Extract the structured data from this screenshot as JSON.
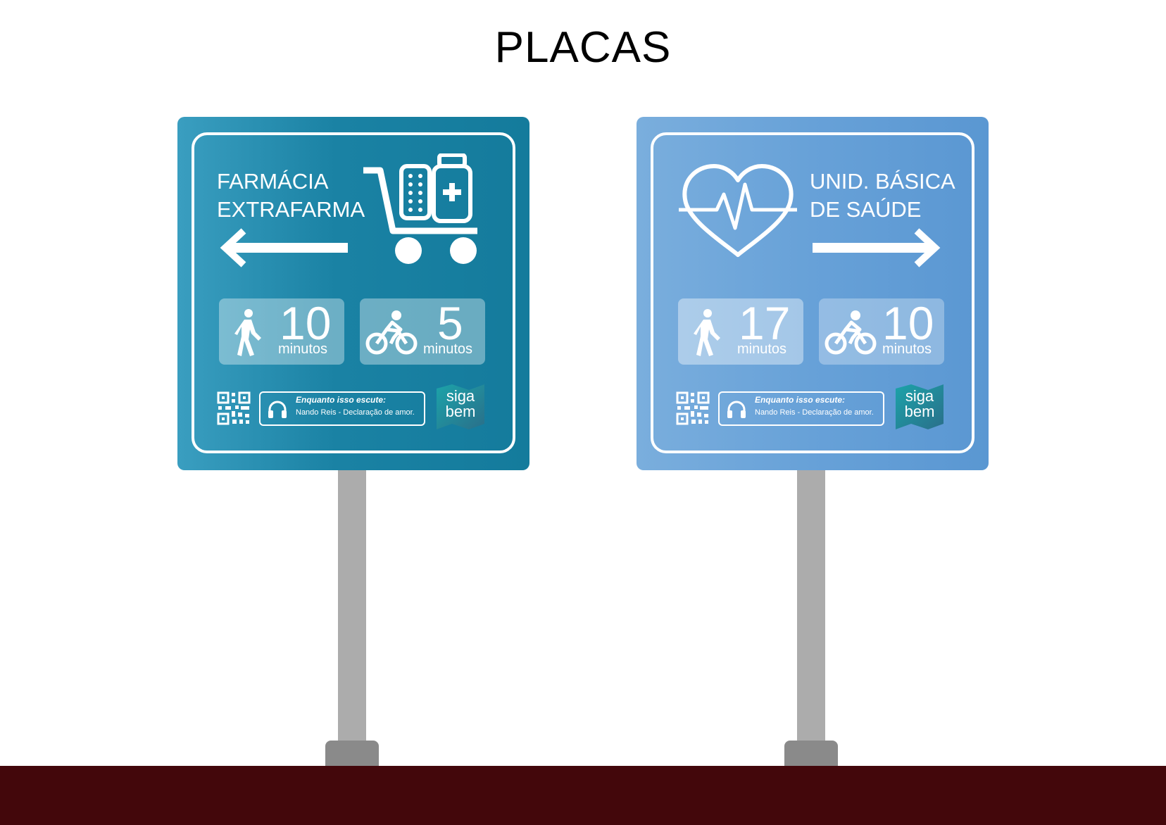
{
  "page": {
    "title": "PLACAS"
  },
  "signs": [
    {
      "title_lines": [
        "FARMÁCIA",
        "EXTRAFARMA"
      ],
      "direction": "left",
      "icon": "cart-medicine-icon",
      "walk": {
        "value": "10",
        "unit": "minutos"
      },
      "bike": {
        "value": "5",
        "unit": "minutos"
      },
      "audio": {
        "label": "Enquanto isso escute:",
        "track": "Nando Reis - Declaração de amor."
      },
      "brand": {
        "line1": "siga",
        "line2": "bem"
      },
      "colors": {
        "start": "#3a9ec0",
        "end": "#147b9c"
      }
    },
    {
      "title_lines": [
        "UNID. BÁSICA",
        "DE SAÚDE"
      ],
      "direction": "right",
      "icon": "heart-pulse-icon",
      "walk": {
        "value": "17",
        "unit": "minutos"
      },
      "bike": {
        "value": "10",
        "unit": "minutos"
      },
      "audio": {
        "label": "Enquanto isso escute:",
        "track": "Nando Reis - Declaração de amor."
      },
      "brand": {
        "line1": "siga",
        "line2": "bem"
      },
      "colors": {
        "start": "#7aaedd",
        "end": "#5a97d2"
      }
    }
  ],
  "colors": {
    "ground": "#43070b",
    "pole": "#acacac",
    "pole_base": "#8a8a8a"
  }
}
